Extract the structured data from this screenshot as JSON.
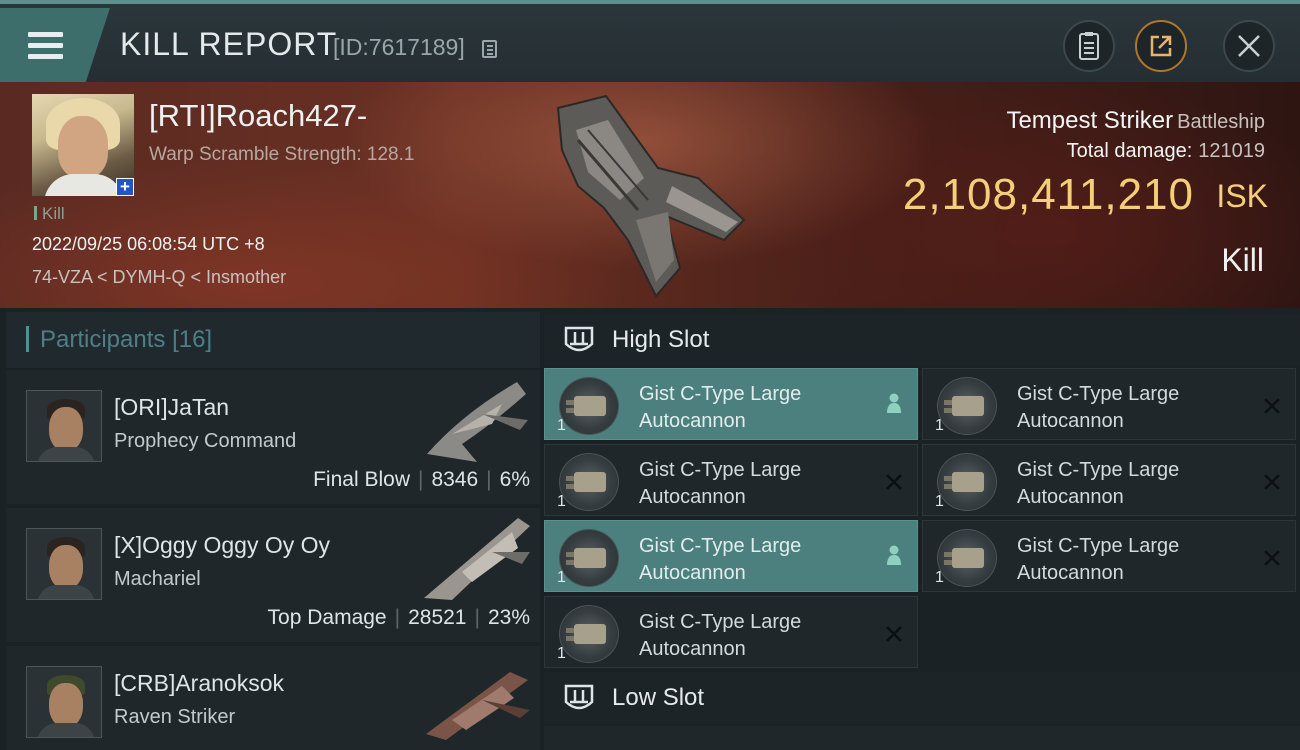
{
  "header": {
    "title": "KILL REPORT",
    "id_text": "[ID:7617189]"
  },
  "victim": {
    "name": "[RTI]Roach427-",
    "scramble": "Warp Scramble Strength: 128.1",
    "tag": "Kill",
    "datetime": "2022/09/25 06:08:54 UTC +8",
    "location": "74-VZA < DYMH-Q < Insmother",
    "ship_name": "Tempest Striker",
    "ship_class": "Battleship",
    "total_damage_label": "Total damage:",
    "total_damage": "121019",
    "isk_value": "2,108,411,210",
    "isk_unit": "ISK",
    "result": "Kill"
  },
  "participants": {
    "label": "Participants",
    "count": "[16]",
    "rows": [
      {
        "name": "[ORI]JaTan",
        "ship": "Prophecy Command",
        "tag": "Final Blow",
        "damage": "8346",
        "percent": "6%"
      },
      {
        "name": "[X]Oggy Oggy Oy Oy",
        "ship": "Machariel",
        "tag": "Top Damage",
        "damage": "28521",
        "percent": "23%"
      },
      {
        "name": "[CRB]Aranoksok",
        "ship": "Raven Striker",
        "tag": "",
        "damage": "",
        "percent": ""
      }
    ]
  },
  "fitting": {
    "high_slot_label": "High Slot",
    "low_slot_label": "Low Slot",
    "modules": [
      {
        "name_line1": "Gist C-Type Large",
        "name_line2": "Autocannon",
        "qty": "1",
        "status": "dropped"
      },
      {
        "name_line1": "Gist C-Type Large",
        "name_line2": "Autocannon",
        "qty": "1",
        "status": "destroyed"
      },
      {
        "name_line1": "Gist C-Type Large",
        "name_line2": "Autocannon",
        "qty": "1",
        "status": "destroyed"
      },
      {
        "name_line1": "Gist C-Type Large",
        "name_line2": "Autocannon",
        "qty": "1",
        "status": "destroyed"
      },
      {
        "name_line1": "Gist C-Type Large",
        "name_line2": "Autocannon",
        "qty": "1",
        "status": "dropped"
      },
      {
        "name_line1": "Gist C-Type Large",
        "name_line2": "Autocannon",
        "qty": "1",
        "status": "destroyed"
      },
      {
        "name_line1": "Gist C-Type Large",
        "name_line2": "Autocannon",
        "qty": "1",
        "status": "destroyed"
      }
    ]
  },
  "icons": {
    "menu": "hamburger-icon",
    "copy": "copy-icon",
    "clipboard": "clipboard-icon",
    "share": "share-icon",
    "close": "close-icon",
    "dropped": "person-icon",
    "destroyed": "x-icon"
  },
  "colors": {
    "accent": "#4b807e",
    "isk": "#f4cf78",
    "participants_label": "#4e7f86",
    "share_ring": "#b2752c"
  }
}
